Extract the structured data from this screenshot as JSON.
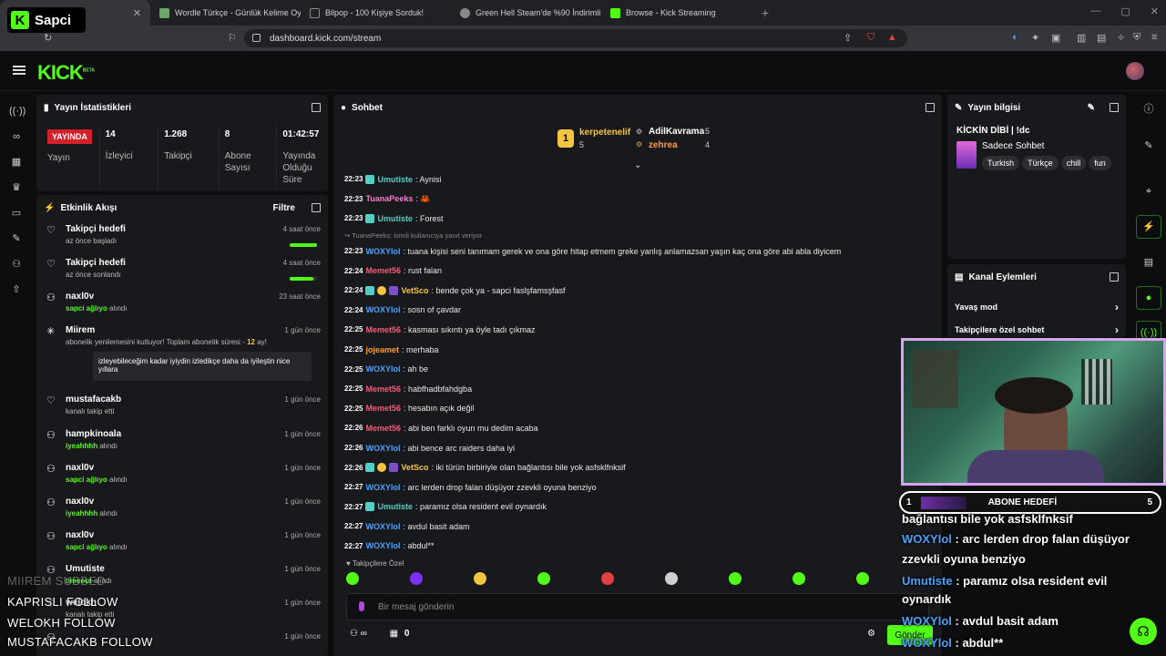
{
  "browser": {
    "tabs": [
      {
        "title": "",
        "color": "#53fc18"
      },
      {
        "title": "Wordle Türkçe - Günlük Kelime Oyu",
        "color": "#6aaa64"
      },
      {
        "title": "Bilpop - 100 Kişiye Sorduk!",
        "color": "#222222"
      },
      {
        "title": "Green Hell Steam'de %90 İndirimli",
        "color": "#888888"
      },
      {
        "title": "Browse - Kick Streaming",
        "color": "#53fc18"
      }
    ],
    "url": "dashboard.kick.com/stream"
  },
  "brand_overlay": {
    "name": "Sapci"
  },
  "app": {
    "logo": "KICK",
    "logo_sup": "BETA"
  },
  "stats": {
    "title": "Yayın İstatistikleri",
    "live_badge": "YAYINDA",
    "live_label": "Yayın",
    "items": [
      {
        "value": "14",
        "label": "İzleyici"
      },
      {
        "value": "1.268",
        "label": "Takipçi"
      },
      {
        "value": "8",
        "label": "Abone Sayısı"
      },
      {
        "value": "01:42:57",
        "label": "Yayında Olduğu Süre"
      }
    ]
  },
  "activity": {
    "title": "Etkinlik Akışı",
    "filter": "Filtre",
    "events": [
      {
        "icon": "heart-icon",
        "name": "Takipçi hedefi",
        "sub": "az önce başladı",
        "time": "4 saat önce",
        "progress": 1.0
      },
      {
        "icon": "heart-icon",
        "name": "Takipçi hedefi",
        "sub": "az önce sonlandı",
        "time": "4 saat önce",
        "progress": 0.85
      },
      {
        "icon": "people-icon",
        "name": "naxl0v",
        "sub_hl": "sapci ağlıyo",
        "sub": "alındı",
        "time": "23 saat önce"
      },
      {
        "icon": "star-icon",
        "name": "Miirem",
        "sub": "abonelik yenilemesini kutluyor! Toplam abonelik süresi -",
        "sub_hl": "12",
        "sub2": "ay!",
        "time": "1 gün önce",
        "quote": "izleyebileceğim kadar iyiydin izledikçe daha da iyileştin nice yıllara"
      },
      {
        "icon": "heart-icon",
        "name": "mustafacakb",
        "sub": "kanalı takip etti",
        "time": "1 gün önce"
      },
      {
        "icon": "people-icon",
        "name": "hampkinoala",
        "sub_hl": "iyeahhhh",
        "sub": "alındı",
        "time": "1 gün önce"
      },
      {
        "icon": "people-icon",
        "name": "naxl0v",
        "sub_hl": "sapci ağlıyo",
        "sub": "alındı",
        "time": "1 gün önce"
      },
      {
        "icon": "people-icon",
        "name": "naxl0v",
        "sub_hl": "iyeahhhh",
        "sub": "alındı",
        "time": "1 gün önce"
      },
      {
        "icon": "people-icon",
        "name": "naxl0v",
        "sub_hl": "sapci ağlıyo",
        "sub": "alındı",
        "time": "1 gün önce"
      },
      {
        "icon": "people-icon",
        "name": "Umutiste",
        "sub_hl": "timeout",
        "sub": "alındı",
        "time": "1 gün önce"
      },
      {
        "icon": "heart-icon",
        "name": "welokh",
        "sub": "kanalı takip etti",
        "time": "1 gün önce"
      },
      {
        "icon": "people-icon",
        "name": "",
        "sub": "",
        "time": "1 gün önce"
      }
    ]
  },
  "chat": {
    "title": "Sohbet",
    "leaders": [
      {
        "rank": "1",
        "name": "kerpetenelif",
        "count": "5"
      },
      {
        "rank": "2",
        "name": "AdilKavrama",
        "count": "5"
      },
      {
        "rank": "3",
        "name": "zehrea",
        "count": "4"
      }
    ],
    "messages": [
      {
        "time": "22:23",
        "badge": true,
        "user": "Umutiste",
        "color": "#53d0c6",
        "text": ": Aynisi"
      },
      {
        "time": "22:23",
        "badge": false,
        "user": "TuanaPeeks",
        "color": "#f080c8",
        "text": ": 🦀"
      },
      {
        "time": "22:23",
        "badge": true,
        "user": "Umutiste",
        "color": "#53d0c6",
        "text": ": Forest"
      },
      {
        "time": "22:23",
        "badge": false,
        "user": "WOXYlol",
        "color": "#4aa2ff",
        "text": ": tuana kişisi seni tanımam gerek ve ona göre hitap etmem greke yanlış anlamazsan yaşın kaç ona göre abi abla diyicem",
        "reply": "TuanaPeeks:  isimli kullanıcıya yanıt veriyor"
      },
      {
        "time": "22:24",
        "badge": false,
        "user": "Memet56",
        "color": "#f05c7a",
        "text": ": rust falan"
      },
      {
        "time": "22:24",
        "badge": true,
        "user": "VetSco",
        "color": "#f5c542",
        "text": ": bende çok ya - sapci faslşfamsşfasf",
        "extra": true
      },
      {
        "time": "22:24",
        "badge": false,
        "user": "WOXYlol",
        "color": "#4aa2ff",
        "text": ": sosn of çavdar"
      },
      {
        "time": "22:25",
        "badge": false,
        "user": "Memet56",
        "color": "#f05c7a",
        "text": ": kasması sıkıntı ya öyle tadı çıkmaz"
      },
      {
        "time": "22:25",
        "badge": false,
        "user": "jojeamet",
        "color": "#ff9a3c",
        "text": ": merhaba"
      },
      {
        "time": "22:25",
        "badge": false,
        "user": "WOXYlol",
        "color": "#4aa2ff",
        "text": ": ah be"
      },
      {
        "time": "22:25",
        "badge": false,
        "user": "Memet56",
        "color": "#f05c7a",
        "text": ": habfhadbfahdgba"
      },
      {
        "time": "22:25",
        "badge": false,
        "user": "Memet56",
        "color": "#f05c7a",
        "text": ": hesabın açık değil"
      },
      {
        "time": "22:26",
        "badge": false,
        "user": "Memet56",
        "color": "#f05c7a",
        "text": ": abi ben farklı oyun mu dedim acaba"
      },
      {
        "time": "22:26",
        "badge": false,
        "user": "WOXYlol",
        "color": "#4aa2ff",
        "text": ": abi bence arc raiders daha iyi"
      },
      {
        "time": "22:26",
        "badge": true,
        "user": "VetSco",
        "color": "#f5c542",
        "text": ": iki türün birbiriyle olan bağlantısı bile yok asfsklfnksif",
        "extra": true
      },
      {
        "time": "22:27",
        "badge": false,
        "user": "WOXYlol",
        "color": "#4aa2ff",
        "text": ": arc lerden drop falan düşüyor zzevkli oyuna benziyo"
      },
      {
        "time": "22:27",
        "badge": true,
        "user": "Umutiste",
        "color": "#53d0c6",
        "text": ": paramız olsa resident evil oynardık"
      },
      {
        "time": "22:27",
        "badge": false,
        "user": "WOXYlol",
        "color": "#4aa2ff",
        "text": ": avdul basit adam"
      },
      {
        "time": "22:27",
        "badge": false,
        "user": "WOXYlol",
        "color": "#4aa2ff",
        "text": ": abdul**"
      }
    ],
    "followers_only_label": "Takipçilere Özel",
    "emote_colors": [
      "#53fc18",
      "#7b2ff7",
      "#f5c542",
      "#53fc18",
      "#e04040",
      "#cfcfcf",
      "#53fc18",
      "#53fc18",
      "#53fc18"
    ],
    "input_placeholder": "Bir mesaj gönderin",
    "footer_count": "0",
    "send_label": "Gönder"
  },
  "stream_info": {
    "title": "Yayın bilgisi",
    "stream_title": "KİCKİN DİBİ | !dc",
    "category": "Sadece Sohbet",
    "tags": [
      "Turkish",
      "Türkçe",
      "chill",
      "fun"
    ]
  },
  "channel_actions": {
    "title": "Kanal Eylemleri",
    "items": [
      "Yavaş mod",
      "Takipçilere özel sohbet"
    ]
  },
  "overlay": {
    "goal_count": "1",
    "goal_label": "ABONE HEDEFİ",
    "goal_target": "5",
    "messages": [
      {
        "user": "",
        "text": "bağlantısı bile yok asfsklfnksif"
      },
      {
        "user": "WOXYlol",
        "text": " : arc lerden drop falan düşüyor"
      },
      {
        "user": "",
        "text": "zzevkli oyuna benziyo"
      },
      {
        "user": "Umutiste",
        "text": " : paramız olsa resident evil"
      },
      {
        "user": "",
        "text": "oynardık"
      },
      {
        "user": "WOXYlol",
        "text": " : avdul basit adam"
      },
      {
        "user": "WOXYlol",
        "text": " : abdul**"
      }
    ],
    "follow_feed": [
      {
        "text": "MIIREM  SUBBED"
      },
      {
        "text": "KAPRISLI  FOLLOW"
      },
      {
        "text": "WELOKH  FOLLOW"
      },
      {
        "text": "MUSTAFACAKB  FOLLOW"
      }
    ]
  }
}
